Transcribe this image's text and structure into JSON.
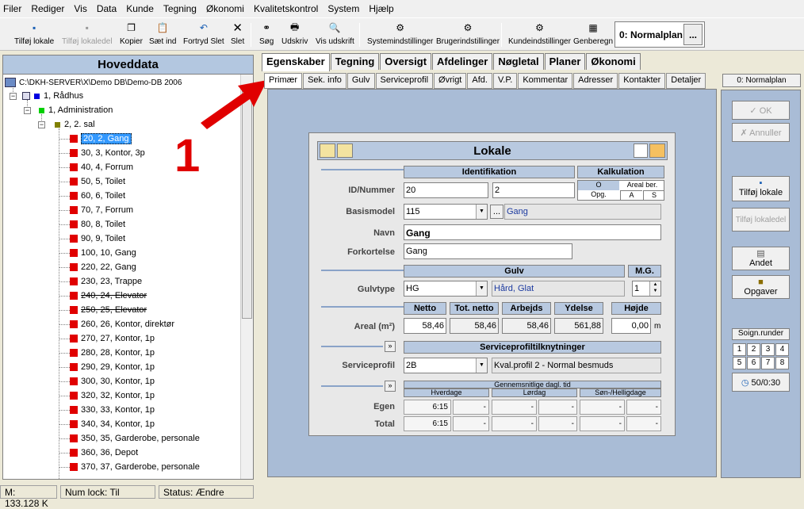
{
  "menu": [
    "Filer",
    "Rediger",
    "Vis",
    "Data",
    "Kunde",
    "Tegning",
    "Økonomi",
    "Kvalitetskontrol",
    "System",
    "Hjælp"
  ],
  "toolbar": {
    "tilfoj_lokale": "Tilføj lokale",
    "tilfoj_lokaledel": "Tilføj lokaledel",
    "kopier": "Kopier",
    "saet_ind": "Sæt ind",
    "fortryd_slet": "Fortryd Slet",
    "slet": "Slet",
    "sog": "Søg",
    "udskriv": "Udskriv",
    "vis_udskrift": "Vis udskrift",
    "systemindstillinger": "Systemindstillinger",
    "brugerindstillinger": "Brugerindstillinger",
    "kundeindstillinger": "Kundeindstillinger",
    "genberegn": "Genberegn",
    "plan": "0: Normalplan",
    "plan_btn": "..."
  },
  "left": {
    "title": "Hoveddata",
    "root": "C:\\DKH-SERVER\\X\\Demo DB\\Demo-DB 2006",
    "building": "1, Rådhus",
    "department": "1, Administration",
    "floor": "2, 2. sal",
    "rooms": [
      "20, 2, Gang",
      "30, 3, Kontor, 3p",
      "40, 4, Forrum",
      "50, 5, Toilet",
      "60, 6, Toilet",
      "70, 7, Forrum",
      "80, 8, Toilet",
      "90, 9, Toilet",
      "100, 10, Gang",
      "220, 22, Gang",
      "230, 23, Trappe",
      "240, 24, Elevator",
      "250, 25, Elevator",
      "260, 26, Kontor, direktør",
      "270, 27, Kontor, 1p",
      "280, 28, Kontor, 1p",
      "290, 29, Kontor, 1p",
      "300, 30, Kontor, 1p",
      "320, 32, Kontor, 1p",
      "330, 33, Kontor, 1p",
      "340, 34, Kontor, 1p",
      "350, 35, Garderobe, personale",
      "360, 36, Depot",
      "370, 37, Garderobe, personale"
    ]
  },
  "status": {
    "memory": "M: 133.128 K",
    "numlock": "Num lock: Til",
    "status": "Status: Ændre"
  },
  "main_tabs": [
    "Egenskaber",
    "Tegning",
    "Oversigt",
    "Afdelinger",
    "Nøgletal",
    "Planer",
    "Økonomi"
  ],
  "sub_tabs": [
    "Primær",
    "Sek. info",
    "Gulv",
    "Serviceprofil",
    "Øvrigt",
    "Afd.",
    "V.P.",
    "Kommentar",
    "Adresser",
    "Kontakter",
    "Detaljer"
  ],
  "plan2": "0: Normalplan",
  "right": {
    "ok": "OK",
    "annuller": "Annuller",
    "tilfoj_lokale": "Tilføj lokale",
    "tilfoj_lokaledel": "Tilføj lokaledel",
    "andet": "Andet",
    "opgaver": "Opgaver",
    "soign": "Soign.runder",
    "nums": [
      "1",
      "2",
      "3",
      "4",
      "5",
      "6",
      "7",
      "8"
    ],
    "timer": "50/0:30"
  },
  "annotation": "1",
  "dialog": {
    "title": "Lokale",
    "identifikation": "Identifikation",
    "kalkulation": "Kalkulation",
    "kalk_o": "O",
    "kalk_areal": "Areal ber.",
    "kalk_opg": "Opg.",
    "kalk_a": "A",
    "kalk_s": "S",
    "id_label": "ID/Nummer",
    "id": "20",
    "nummer": "2",
    "basismodel_label": "Basismodel",
    "basismodel": "115",
    "basismodel_btn": "...",
    "basismodel_desc": "Gang",
    "navn_label": "Navn",
    "navn": "Gang",
    "forkortelse_label": "Forkortelse",
    "forkortelse": "Gang",
    "gulv_hdr": "Gulv",
    "mg_hdr": "M.G.",
    "gulvtype_label": "Gulvtype",
    "gulvtype": "HG",
    "gulvtype_desc": "Hård, Glat",
    "mg": "1",
    "netto_hdr": "Netto",
    "totnetto_hdr": "Tot. netto",
    "arbejds_hdr": "Arbejds",
    "ydelse_hdr": "Ydelse",
    "hojde_hdr": "Højde",
    "areal_label": "Areal (m²)",
    "netto": "58,46",
    "totnetto": "58,46",
    "arbejds": "58,46",
    "ydelse": "561,88",
    "hojde": "0,00",
    "hojde_unit": "m",
    "sp_btn": "»",
    "sp_hdr": "Serviceprofiltilknytninger",
    "sp_label": "Serviceprofil",
    "sp": "2B",
    "sp_desc": "Kval.profil 2 - Normal besmuds",
    "gt_btn": "»",
    "gt_hdr": "Gennemsnitlige dagl. tid",
    "hverdage": "Hverdage",
    "lordag": "Lørdag",
    "sondag": "Søn-/Helligdage",
    "egen_label": "Egen",
    "total_label": "Total",
    "egen_val": "6:15",
    "total_val": "6:15",
    "dash": "-"
  }
}
